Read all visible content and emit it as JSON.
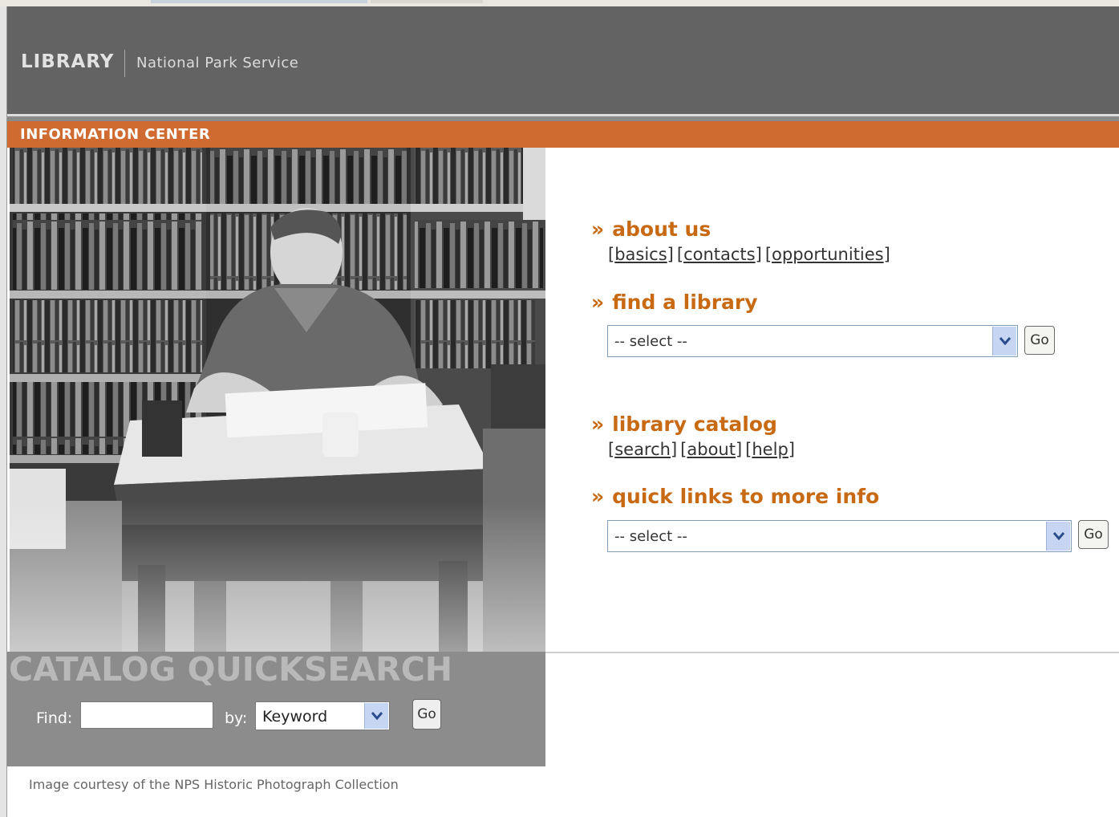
{
  "header": {
    "title": "LIBRARY",
    "subtitle": "National Park Service"
  },
  "banner": {
    "label": "INFORMATION CENTER"
  },
  "quicksearch": {
    "title": "CATALOG QUICKSEARCH",
    "find_label": "Find:",
    "find_value": "",
    "by_label": "by:",
    "by_value": "Keyword",
    "go_label": "Go"
  },
  "credit": "Image courtesy of the NPS Historic Photograph Collection",
  "sections": {
    "about": {
      "marker": "»",
      "title": "about us",
      "links": [
        "basics",
        "contacts",
        "opportunities"
      ]
    },
    "find_library": {
      "marker": "»",
      "title": "find a library",
      "select_value": "-- select --",
      "go_label": "Go"
    },
    "catalog": {
      "marker": "»",
      "title": "library catalog",
      "links": [
        "search",
        "about",
        "help"
      ]
    },
    "quick_links": {
      "marker": "»",
      "title": "quick links to more info",
      "select_value": "-- select --",
      "go_label": "Go"
    }
  },
  "icons": {
    "dropdown": "chevron-down-icon"
  },
  "colors": {
    "header_bg": "#636363",
    "banner_bg": "#cf6a30",
    "heading": "#c86a14",
    "panel_bg": "#8c8c8c"
  }
}
